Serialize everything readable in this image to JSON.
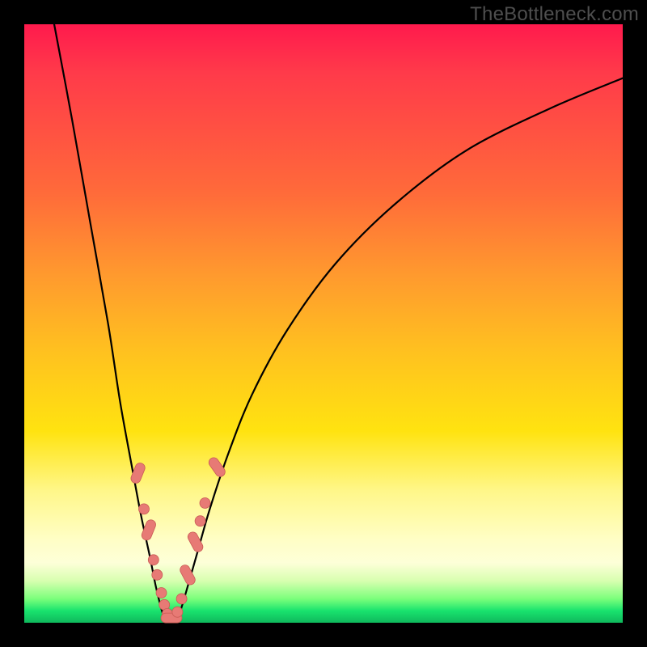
{
  "watermark": "TheBottleneck.com",
  "colors": {
    "background": "#000000",
    "gradient_top": "#ff1a4d",
    "gradient_mid": "#ffe310",
    "gradient_bottom": "#0fb85c",
    "curve": "#000000",
    "marker": "#e77a75"
  },
  "chart_data": {
    "type": "line",
    "title": "",
    "xlabel": "",
    "ylabel": "",
    "xlim": [
      0,
      100
    ],
    "ylim": [
      0,
      100
    ],
    "grid": false,
    "legend": false,
    "note": "Axes are unlabeled; values below are normalized 0–100 estimated from pixel positions. y increases upward (0 = bottom green band, 100 = top edge of gradient).",
    "series": [
      {
        "name": "left-curve",
        "x": [
          5,
          8,
          11,
          14,
          16,
          18,
          19.5,
          21,
          22,
          23,
          23.7
        ],
        "y": [
          100,
          84,
          67,
          50,
          37,
          26,
          18,
          11,
          6,
          2,
          0
        ]
      },
      {
        "name": "right-curve",
        "x": [
          25.5,
          27,
          29,
          31,
          34,
          38,
          44,
          52,
          62,
          74,
          88,
          100
        ],
        "y": [
          0,
          5,
          12,
          19,
          28,
          38,
          49,
          60,
          70,
          79,
          86,
          91
        ]
      }
    ],
    "markers": {
      "note": "salmon dots/oblongs on the lower V; same normalized coords",
      "points": [
        {
          "x": 19.0,
          "y": 25.0,
          "shape": "oblong",
          "angle": -68
        },
        {
          "x": 20.0,
          "y": 19.0,
          "shape": "circle"
        },
        {
          "x": 20.8,
          "y": 15.5,
          "shape": "oblong",
          "angle": -68
        },
        {
          "x": 21.6,
          "y": 10.5,
          "shape": "circle"
        },
        {
          "x": 22.2,
          "y": 8.0,
          "shape": "circle"
        },
        {
          "x": 22.9,
          "y": 5.0,
          "shape": "circle"
        },
        {
          "x": 23.4,
          "y": 3.0,
          "shape": "circle"
        },
        {
          "x": 23.9,
          "y": 1.5,
          "shape": "circle"
        },
        {
          "x": 24.6,
          "y": 0.8,
          "shape": "oblong",
          "angle": 0
        },
        {
          "x": 25.6,
          "y": 1.8,
          "shape": "circle"
        },
        {
          "x": 26.3,
          "y": 4.0,
          "shape": "circle"
        },
        {
          "x": 27.3,
          "y": 8.0,
          "shape": "oblong",
          "angle": 62
        },
        {
          "x": 28.6,
          "y": 13.5,
          "shape": "oblong",
          "angle": 62
        },
        {
          "x": 29.4,
          "y": 17.0,
          "shape": "circle"
        },
        {
          "x": 30.2,
          "y": 20.0,
          "shape": "circle"
        },
        {
          "x": 32.2,
          "y": 26.0,
          "shape": "oblong",
          "angle": 55
        }
      ]
    }
  }
}
